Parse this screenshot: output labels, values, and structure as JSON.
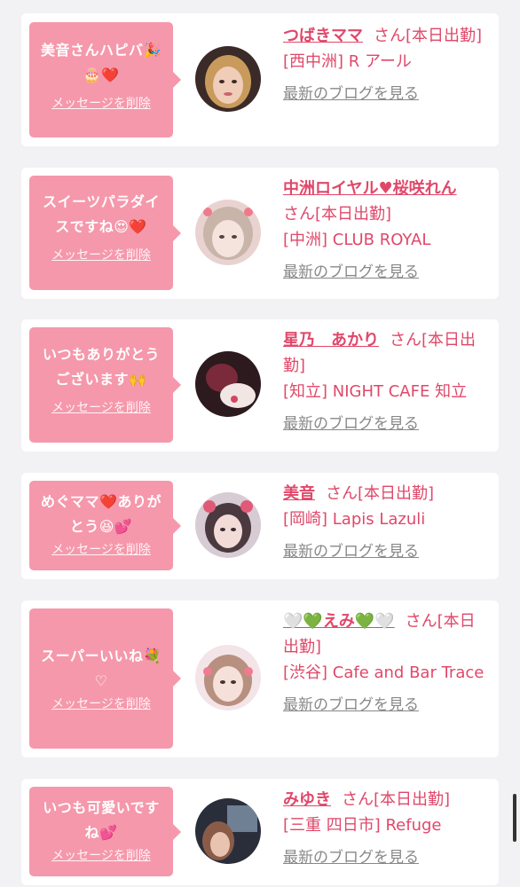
{
  "delete_label": "メッセージを削除",
  "blog_label": "最新のブログを見る",
  "status_suffix": "さん[本日出勤]",
  "colors": {
    "bubble": "#f598ab",
    "accent": "#e0486a",
    "link_gray": "#888888",
    "card": "#ffffff",
    "bg": "#f2f2f4"
  },
  "items": [
    {
      "message": "美音さんハピバ🎉🎂❤️",
      "name": "つばきママ",
      "shop": "[西中洲] R アール",
      "avatar_icon": "avatar-woman-blonde"
    },
    {
      "message": "スイーツパラダイスですね😍❤️",
      "name": "中洲ロイヤル♥桜咲れん",
      "shop": "[中洲] CLUB ROYAL",
      "avatar_icon": "avatar-woman-filter"
    },
    {
      "message": "いつもありがとうございます🙌",
      "name": "星乃　あかり",
      "shop": "[知立] NIGHT CAFE 知立",
      "avatar_icon": "avatar-woman-dark"
    },
    {
      "message": "めぐママ❤️ありがとう😆💕",
      "name": "美音",
      "shop": "[岡崎] Lapis Lazuli",
      "avatar_icon": "avatar-woman-ears"
    },
    {
      "message": "スーパーいいね💐♡",
      "name": "🤍💚えみ💚🤍",
      "shop": "[渋谷] Cafe and Bar Trace",
      "avatar_icon": "avatar-woman-pink"
    },
    {
      "message": "いつも可愛いですね💕",
      "name": "みゆき",
      "shop": "[三重 四日市] Refuge",
      "avatar_icon": "avatar-woman-night"
    }
  ]
}
